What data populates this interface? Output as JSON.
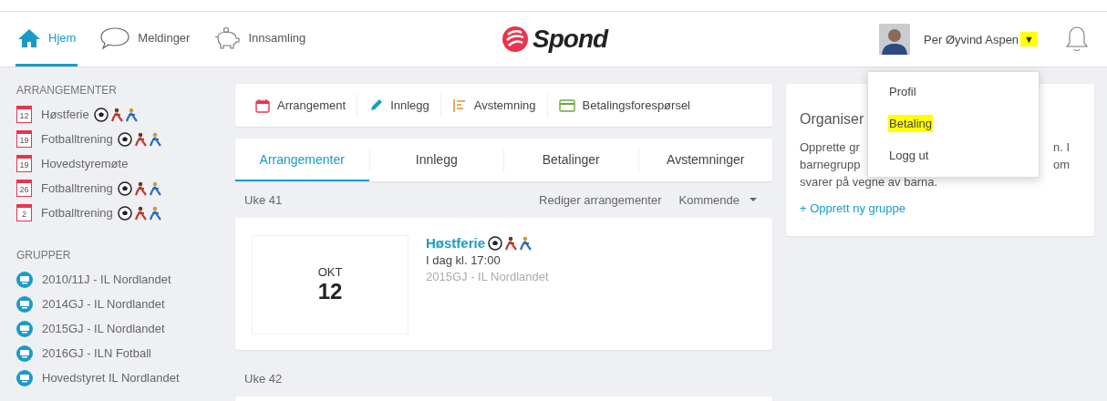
{
  "nav": [
    {
      "label": "Hjem",
      "kind": "home",
      "selected": true
    },
    {
      "label": "Meldinger",
      "kind": "chat",
      "selected": false
    },
    {
      "label": "Innsamling",
      "kind": "piggy",
      "selected": false
    }
  ],
  "logo": {
    "text": "Spond"
  },
  "user": {
    "name": "Per Øyvind Aspen",
    "caret": "▼",
    "caret_highlighted": true
  },
  "user_menu": [
    {
      "label": "Profil",
      "highlighted": false
    },
    {
      "label": "Betaling",
      "highlighted": true
    },
    {
      "label": "Logg ut",
      "highlighted": false
    }
  ],
  "sidebar": {
    "events_heading": "ARRANGEMENTER",
    "events": [
      {
        "day": "12",
        "title": "Høstferie",
        "sport_icons": true
      },
      {
        "day": "19",
        "title": "Fotballtrening",
        "sport_icons": true
      },
      {
        "day": "19",
        "title": "Hovedstyremøte",
        "sport_icons": false
      },
      {
        "day": "26",
        "title": "Fotballtrening",
        "sport_icons": true
      },
      {
        "day": "2",
        "title": "Fotballtrening",
        "sport_icons": true
      }
    ],
    "groups_heading": "GRUPPER",
    "groups": [
      "2010/11J - IL Nordlandet",
      "2014GJ - IL Nordlandet",
      "2015GJ - IL Nordlandet",
      "2016GJ - ILN Fotball",
      "Hovedstyret IL Nordlandet"
    ]
  },
  "actions": [
    {
      "label": "Arrangement",
      "kind": "calendar"
    },
    {
      "label": "Innlegg",
      "kind": "pencil"
    },
    {
      "label": "Avstemning",
      "kind": "poll"
    },
    {
      "label": "Betalingsforespørsel",
      "kind": "card"
    }
  ],
  "tabs": [
    {
      "label": "Arrangementer",
      "selected": true
    },
    {
      "label": "Innlegg",
      "selected": false
    },
    {
      "label": "Betalinger",
      "selected": false
    },
    {
      "label": "Avstemninger",
      "selected": false
    }
  ],
  "weeks": [
    {
      "label": "Uke 41",
      "edit_link": "Rediger arrangementer",
      "filter": "Kommende",
      "events": [
        {
          "month": "OKT",
          "day": "12",
          "title": "Høstferie",
          "sport_icons": true,
          "time": "I dag kl. 17:00",
          "group": "2015GJ - IL Nordlandet"
        }
      ]
    },
    {
      "label": "Uke 42"
    }
  ],
  "org_card": {
    "title": "Organiser",
    "lines": [
      {
        "left": "Opprette gr",
        "right": "n. I"
      },
      {
        "left": "barnegrupp",
        "right": "om"
      },
      {
        "left": "svarer på vegne av barna."
      }
    ],
    "link": "+ Opprett ny gruppe"
  }
}
